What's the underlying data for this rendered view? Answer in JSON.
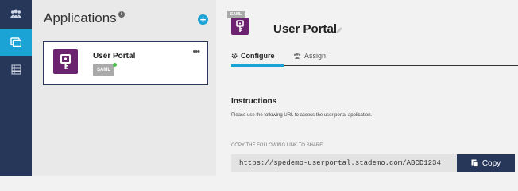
{
  "sidebar": {
    "items": [
      {
        "icon": "users-icon",
        "active": false
      },
      {
        "icon": "windows-icon",
        "active": true
      },
      {
        "icon": "list-icon",
        "active": false
      }
    ]
  },
  "apps_panel": {
    "title": "Applications",
    "info_glyph": "i",
    "add_glyph": "+",
    "cards": [
      {
        "name": "User Portal",
        "badge": "SAML",
        "status_color": "#4cc14c",
        "more": "•••"
      }
    ]
  },
  "detail": {
    "badge": "SAML",
    "title": "User Portal",
    "tabs": [
      {
        "label": "Configure",
        "active": true
      },
      {
        "label": "Assign",
        "active": false
      }
    ],
    "instructions_title": "Instructions",
    "instructions_text": "Please use the following URL to access the user portal application.",
    "copy_label": "COPY THE FOLLOWING LINK TO SHARE.",
    "url": "https://spedemo-userportal.stademo.com/ABCD1234",
    "copy_button": "Copy"
  },
  "colors": {
    "sidebar": "#27375a",
    "accent": "#1ba3d6",
    "app_icon": "#6b2370",
    "status": "#4cc14c"
  }
}
